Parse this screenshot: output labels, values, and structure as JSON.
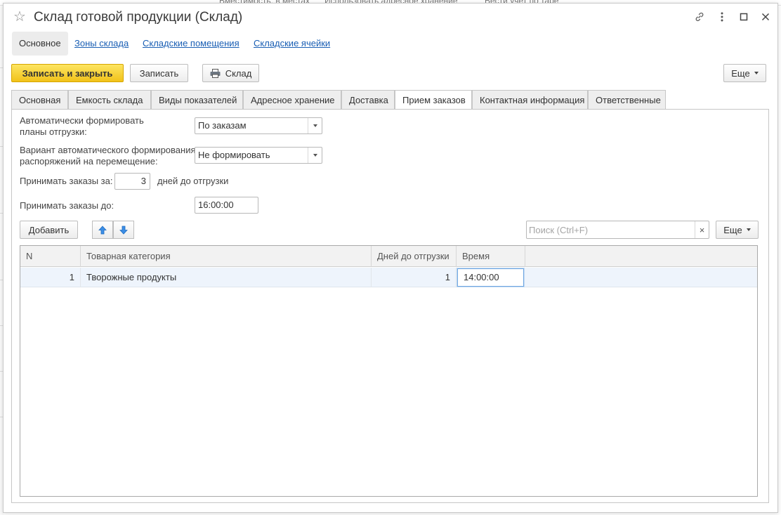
{
  "window": {
    "title": "Склад готовой продукции (Склад)",
    "icons": [
      "star-icon",
      "link-icon",
      "more-vertical-icon",
      "maximize-icon",
      "close-icon"
    ]
  },
  "navbar": {
    "items": [
      {
        "label": "Основное",
        "active": true
      },
      {
        "label": "Зоны склада"
      },
      {
        "label": "Складские помещения"
      },
      {
        "label": "Складские ячейки"
      }
    ]
  },
  "toolbar": {
    "save_close": "Записать и закрыть",
    "save": "Записать",
    "warehouse": "Склад",
    "more": "Еще"
  },
  "tabs": [
    {
      "label": "Основная"
    },
    {
      "label": "Емкость склада"
    },
    {
      "label": "Виды показателей"
    },
    {
      "label": "Адресное хранение"
    },
    {
      "label": "Доставка"
    },
    {
      "label": "Прием заказов",
      "active": true
    },
    {
      "label": "Контактная информация"
    },
    {
      "label": "Ответственные"
    }
  ],
  "form": {
    "auto_plans_label_line1": "Автоматически формировать",
    "auto_plans_label_line2": "планы отгрузки:",
    "auto_plans_value": "По заказам",
    "auto_transfer_label_line1": "Вариант автоматического формирования",
    "auto_transfer_label_line2": "распоряжений на перемещение:",
    "auto_transfer_value": "Не формировать",
    "accept_for_label": "Принимать заказы за:",
    "accept_for_value": "3",
    "accept_for_suffix": "дней до отгрузки",
    "accept_until_label": "Принимать заказы до:",
    "accept_until_value": "16:00:00"
  },
  "table_toolbar": {
    "add": "Добавить",
    "search_placeholder": "Поиск (Ctrl+F)",
    "clear": "×",
    "more": "Еще"
  },
  "table": {
    "headers": [
      "N",
      "Товарная категория",
      "Дней до отгрузки",
      "Время"
    ],
    "rows": [
      {
        "n": "1",
        "category": "Творожные продукты",
        "days": "1",
        "time": "14:00:00"
      }
    ]
  },
  "background": {
    "fragments": [
      "Вместимость, в местах",
      "Использовать адресное хранение",
      "Вести учет по таре"
    ]
  },
  "colors": {
    "primary_button": "#f1c21a",
    "link": "#1a5fb4",
    "selected_row": "#eef4fc",
    "arrow_icon": "#3c8ee6"
  }
}
